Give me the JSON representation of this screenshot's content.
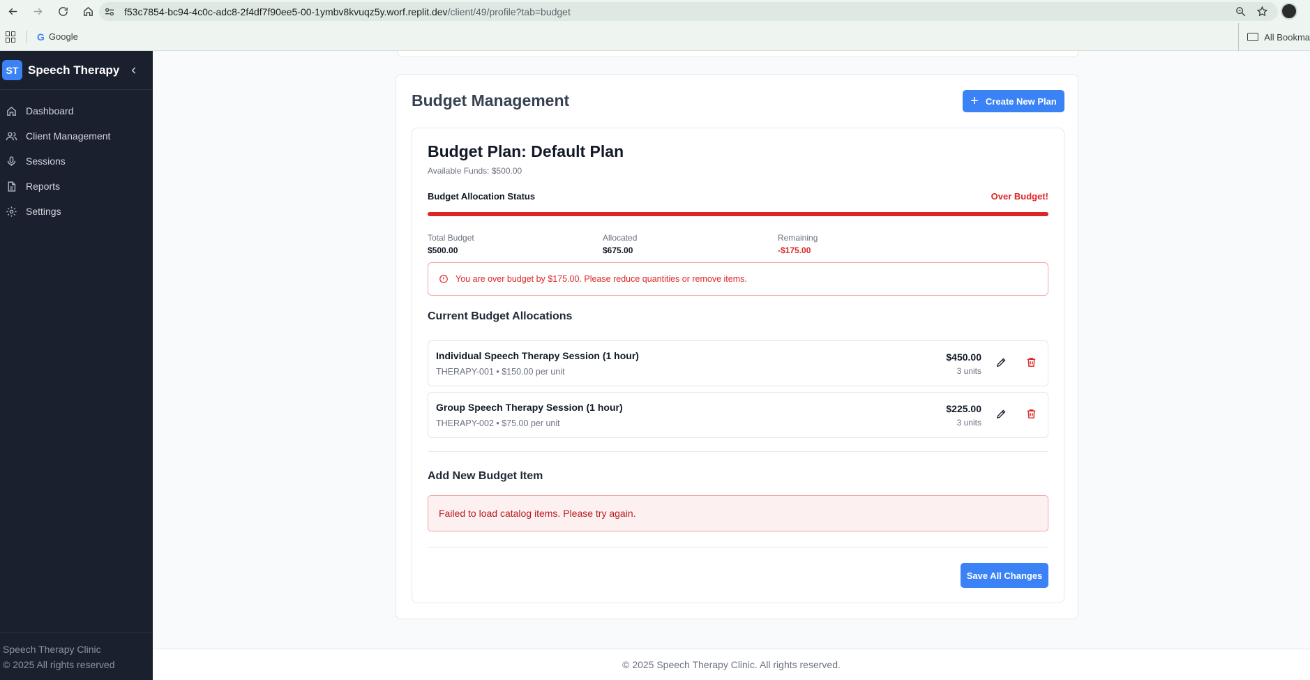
{
  "browser": {
    "url_host": "f53c7854-bc94-4c0c-adc8-2f4df7f90ee5-00-1ymbv8kvuqz5y.worf.replit.dev",
    "url_path": "/client/49/profile?tab=budget",
    "bookmarks": {
      "google": "Google",
      "all_bookmarks": "All Bookma"
    }
  },
  "sidebar": {
    "brand_initials": "ST",
    "brand_name": "Speech Therapy",
    "items": [
      {
        "label": "Dashboard",
        "icon": "home-icon"
      },
      {
        "label": "Client Management",
        "icon": "users-icon"
      },
      {
        "label": "Sessions",
        "icon": "mic-icon"
      },
      {
        "label": "Reports",
        "icon": "file-icon"
      },
      {
        "label": "Settings",
        "icon": "gear-icon"
      }
    ],
    "footer_line1": "Speech Therapy Clinic",
    "footer_line2": "© 2025 All rights reserved"
  },
  "budget": {
    "section_title": "Budget Management",
    "create_button": "Create New Plan",
    "plan_title": "Budget Plan: Default Plan",
    "available_funds": "Available Funds: $500.00",
    "status_label": "Budget Allocation Status",
    "status_value": "Over Budget!",
    "progress_fraction": 1.0,
    "stats": {
      "total_label": "Total Budget",
      "total_value": "$500.00",
      "allocated_label": "Allocated",
      "allocated_value": "$675.00",
      "remaining_label": "Remaining",
      "remaining_value": "-$175.00"
    },
    "over_budget_alert": "You are over budget by $175.00. Please reduce quantities or remove items.",
    "allocations_title": "Current Budget Allocations",
    "allocations": [
      {
        "name": "Individual Speech Therapy Session (1 hour)",
        "meta": "THERAPY-001 • $150.00 per unit",
        "amount": "$450.00",
        "units": "3 units"
      },
      {
        "name": "Group Speech Therapy Session (1 hour)",
        "meta": "THERAPY-002 • $75.00 per unit",
        "amount": "$225.00",
        "units": "3 units"
      }
    ],
    "add_item_title": "Add New Budget Item",
    "catalog_error": "Failed to load catalog items. Please try again.",
    "save_button": "Save All Changes"
  },
  "footer": {
    "text": "© 2025 Speech Therapy Clinic. All rights reserved."
  },
  "colors": {
    "accent": "#3b82f6",
    "danger": "#dc2626",
    "sidebar_bg": "#1a202e"
  }
}
